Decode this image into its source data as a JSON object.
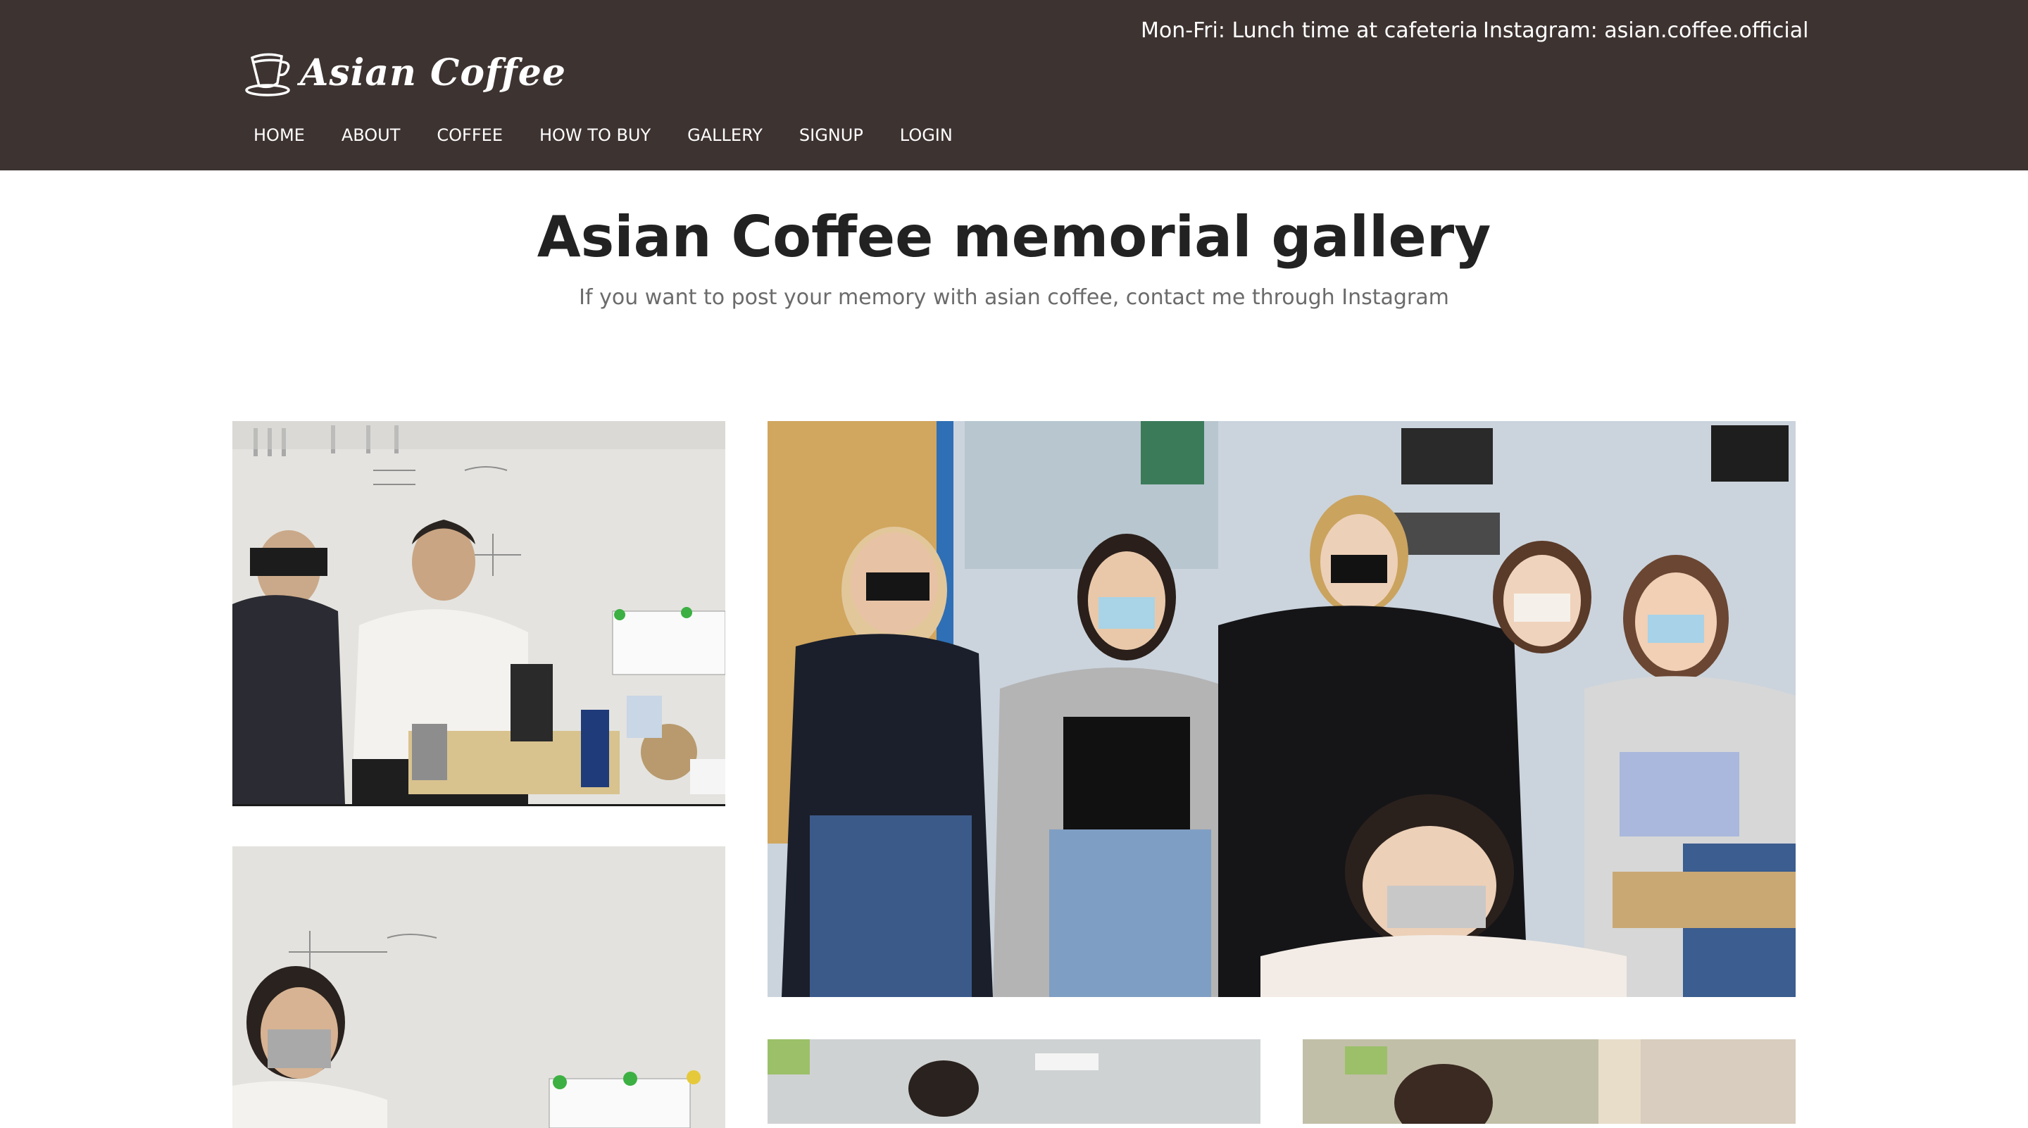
{
  "header": {
    "hours": "Mon-Fri: Lunch time at cafeteria",
    "instagram": "Instagram: asian.coffee.official",
    "logo_text": "Asian Coffee",
    "logo_icon": "coffee-cup-icon"
  },
  "nav": {
    "items": [
      {
        "label": "HOME"
      },
      {
        "label": "ABOUT"
      },
      {
        "label": "COFFEE"
      },
      {
        "label": "HOW TO BUY"
      },
      {
        "label": "GALLERY"
      },
      {
        "label": "SIGNUP"
      },
      {
        "label": "LOGIN"
      }
    ]
  },
  "page": {
    "title": "Asian Coffee memorial gallery",
    "subtitle": "If you want to post your memory with asian coffee, contact me through Instagram"
  },
  "colors": {
    "header_bg": "#3d3331",
    "header_text": "#ffffff",
    "title": "#222222",
    "subtitle": "#6b6b6b"
  }
}
